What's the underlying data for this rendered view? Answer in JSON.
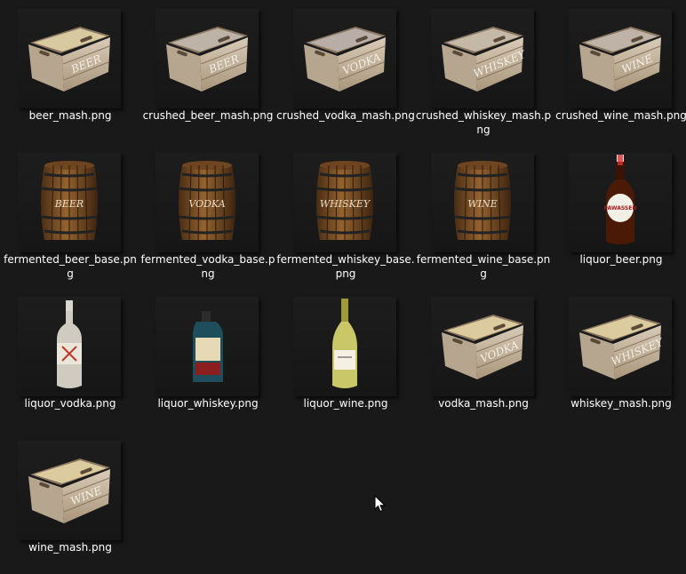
{
  "window": {
    "background": "#191919",
    "text_color": "#ffffff"
  },
  "files": [
    {
      "name": "beer_mash.png",
      "kind": "crate",
      "label": "BEER",
      "fill": "#d9c9a1"
    },
    {
      "name": "crushed_beer_mash.png",
      "kind": "crate",
      "label": "BEER",
      "fill": "#bdb3a6"
    },
    {
      "name": "crushed_vodka_mash.png",
      "kind": "crate",
      "label": "VODKA",
      "fill": "#b9aea7"
    },
    {
      "name": "crushed_whiskey_mash.png",
      "kind": "crate",
      "label": "WHISKEY",
      "fill": "#c4b8a6"
    },
    {
      "name": "crushed_wine_mash.png",
      "kind": "crate",
      "label": "WINE",
      "fill": "#bfb2a7"
    },
    {
      "name": "fermented_beer_base.png",
      "kind": "barrel",
      "label": "BEER"
    },
    {
      "name": "fermented_vodka_base.png",
      "kind": "barrel",
      "label": "VODKA"
    },
    {
      "name": "fermented_whiskey_base.png",
      "kind": "barrel",
      "label": "WHISKEY"
    },
    {
      "name": "fermented_wine_base.png",
      "kind": "barrel",
      "label": "WINE"
    },
    {
      "name": "liquor_beer.png",
      "kind": "bottle-beer",
      "label": "PAWASSEN"
    },
    {
      "name": "liquor_vodka.png",
      "kind": "bottle-vodka",
      "label": ""
    },
    {
      "name": "liquor_whiskey.png",
      "kind": "bottle-whiskey",
      "label": ""
    },
    {
      "name": "liquor_wine.png",
      "kind": "bottle-wine",
      "label": ""
    },
    {
      "name": "vodka_mash.png",
      "kind": "crate",
      "label": "VODKA",
      "fill": "#dccb9f"
    },
    {
      "name": "whiskey_mash.png",
      "kind": "crate",
      "label": "WHISKEY",
      "fill": "#dccb9f"
    },
    {
      "name": "wine_mash.png",
      "kind": "crate",
      "label": "WINE",
      "fill": "#dccb9f"
    }
  ]
}
